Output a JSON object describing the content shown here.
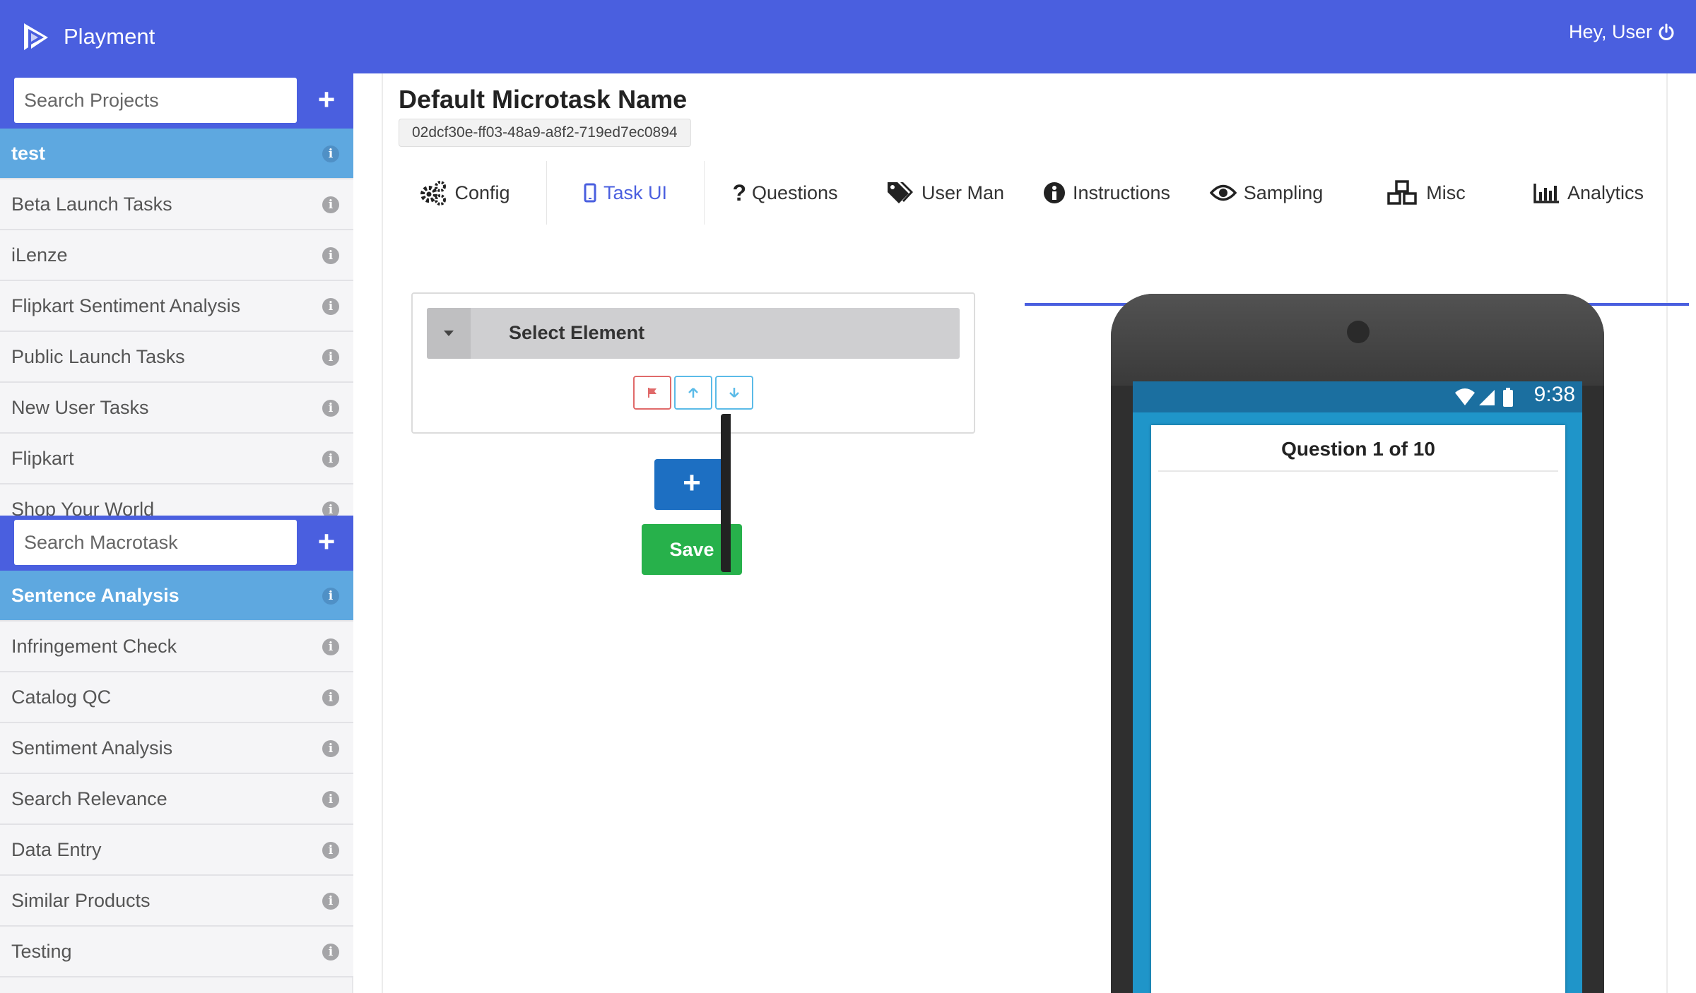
{
  "app": {
    "name": "Playment",
    "greeting": "Hey, User",
    "accent": "#4a5fdf"
  },
  "projects": {
    "search_placeholder": "Search Projects",
    "items": [
      {
        "label": "test",
        "active": true
      },
      {
        "label": "Beta Launch Tasks"
      },
      {
        "label": "iLenze"
      },
      {
        "label": "Flipkart Sentiment Analysis"
      },
      {
        "label": "Public Launch Tasks"
      },
      {
        "label": "New User Tasks"
      },
      {
        "label": "Flipkart"
      },
      {
        "label": "Shop Your World"
      }
    ]
  },
  "macrotasks": {
    "search_placeholder": "Search Macrotask",
    "items": [
      {
        "label": "Sentence Analysis",
        "active": true
      },
      {
        "label": "Infringement Check"
      },
      {
        "label": "Catalog QC"
      },
      {
        "label": "Sentiment Analysis"
      },
      {
        "label": "Search Relevance"
      },
      {
        "label": "Data Entry"
      },
      {
        "label": "Similar Products"
      },
      {
        "label": "Testing"
      }
    ]
  },
  "microtask": {
    "title": "Default Microtask Name",
    "uuid": "02dcf30e-ff03-48a9-a8f2-719ed7ec0894"
  },
  "tabs": [
    {
      "label": "Config",
      "icon": "gears-icon"
    },
    {
      "label": "Task UI",
      "icon": "mobile-icon",
      "active": true
    },
    {
      "label": "Questions",
      "icon": "question-icon"
    },
    {
      "label": "User Man",
      "icon": "tags-icon"
    },
    {
      "label": "Instructions",
      "icon": "info-circle-icon"
    },
    {
      "label": "Sampling",
      "icon": "eye-icon"
    },
    {
      "label": "Misc",
      "icon": "cubes-icon"
    },
    {
      "label": "Analytics",
      "icon": "bar-chart-icon"
    }
  ],
  "editor": {
    "select_label": "Select Element",
    "add_label": "+",
    "save_label": "Save",
    "save_color": "#27b14b",
    "add_color": "#1d6fc2"
  },
  "phone": {
    "time": "9:38",
    "question_title": "Question 1 of 10"
  }
}
